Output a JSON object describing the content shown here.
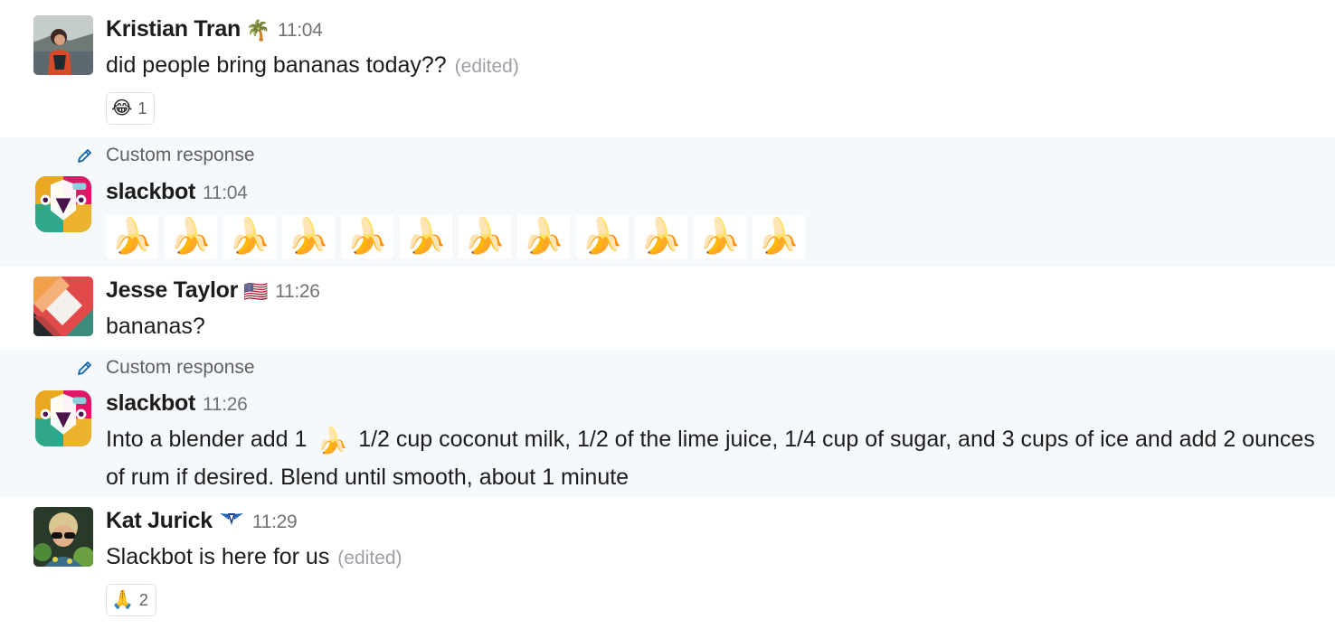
{
  "messages": [
    {
      "author": "Kristian Tran",
      "status_emoji": "🌴",
      "time": "11:04",
      "text": "did people bring bananas today??",
      "edited": "(edited)",
      "reaction": {
        "emoji": "😂",
        "count": "1"
      }
    },
    {
      "custom_label": "Custom response",
      "author": "slackbot",
      "time": "11:04",
      "bananas": [
        "🍌",
        "🍌",
        "🍌",
        "🍌",
        "🍌",
        "🍌",
        "🍌",
        "🍌",
        "🍌",
        "🍌",
        "🍌",
        "🍌"
      ]
    },
    {
      "author": "Jesse Taylor",
      "status_emoji": "🇺🇸",
      "time": "11:26",
      "text": "bananas?"
    },
    {
      "custom_label": "Custom response",
      "author": "slackbot",
      "time": "11:26",
      "text_before": "Into a blender add 1",
      "inline_emoji": "🍌",
      "text_after": "1/2 cup coconut milk, 1/2 of the lime juice, 1/4 cup of sugar, and 3 cups of ice and add 2 ounces of rum if desired. Blend until smooth, about 1 minute"
    },
    {
      "author": "Kat Jurick",
      "status_emoji": "💠",
      "time": "11:29",
      "text": "Slackbot is here for us",
      "edited": "(edited)",
      "reaction": {
        "emoji": "🙏",
        "count": "2"
      }
    }
  ],
  "colors": {
    "bot_highlight_bg": "#f6f9fc",
    "timestamp": "#717274",
    "edited": "#9e9ea6",
    "pencil": "#1264a3"
  }
}
